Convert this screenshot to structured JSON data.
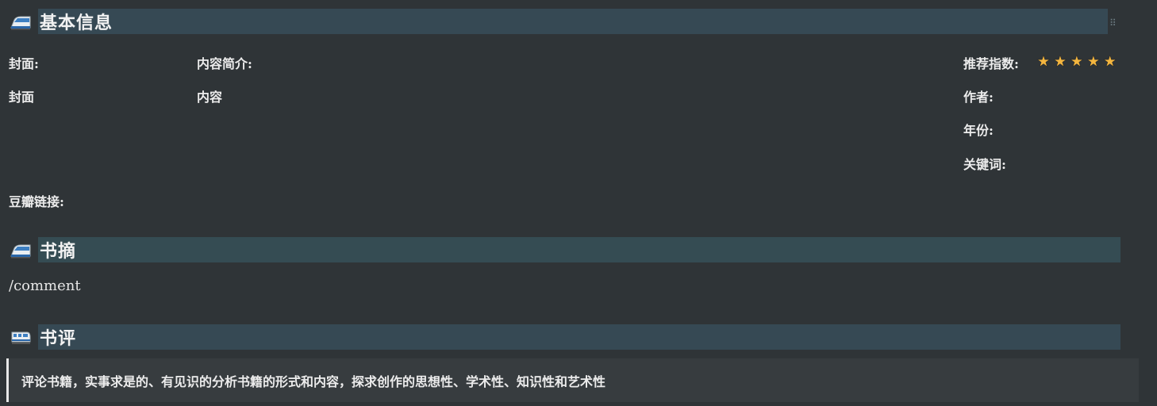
{
  "sections": {
    "basic_info": {
      "title": "基本信息",
      "bg_color": "#364954"
    },
    "excerpts": {
      "title": "书摘",
      "bg_color": "#354c53",
      "content": "/comment"
    },
    "review": {
      "title": "书评",
      "bg_color": "#364954",
      "quote": "评论书籍，实事求是的、有见识的分析书籍的形式和内容，探求创作的思想性、学术性、知识性和艺术性"
    }
  },
  "fields": {
    "cover_label": "封面:",
    "cover_value": "封面",
    "summary_label": "内容简介:",
    "summary_value": "内容",
    "rating_label": "推荐指数:",
    "rating_stars": 5,
    "author_label": "作者:",
    "year_label": "年份:",
    "keywords_label": "关键词:",
    "douban_label": "豆瓣链接:"
  },
  "icons": {
    "heading_icon": "train-icon",
    "drag_icon": "drag-handle-icon",
    "star_icon": "star-icon"
  },
  "colors": {
    "background": "#2f3437",
    "star": "#f4b63f",
    "quote_bg": "#373c3f"
  }
}
